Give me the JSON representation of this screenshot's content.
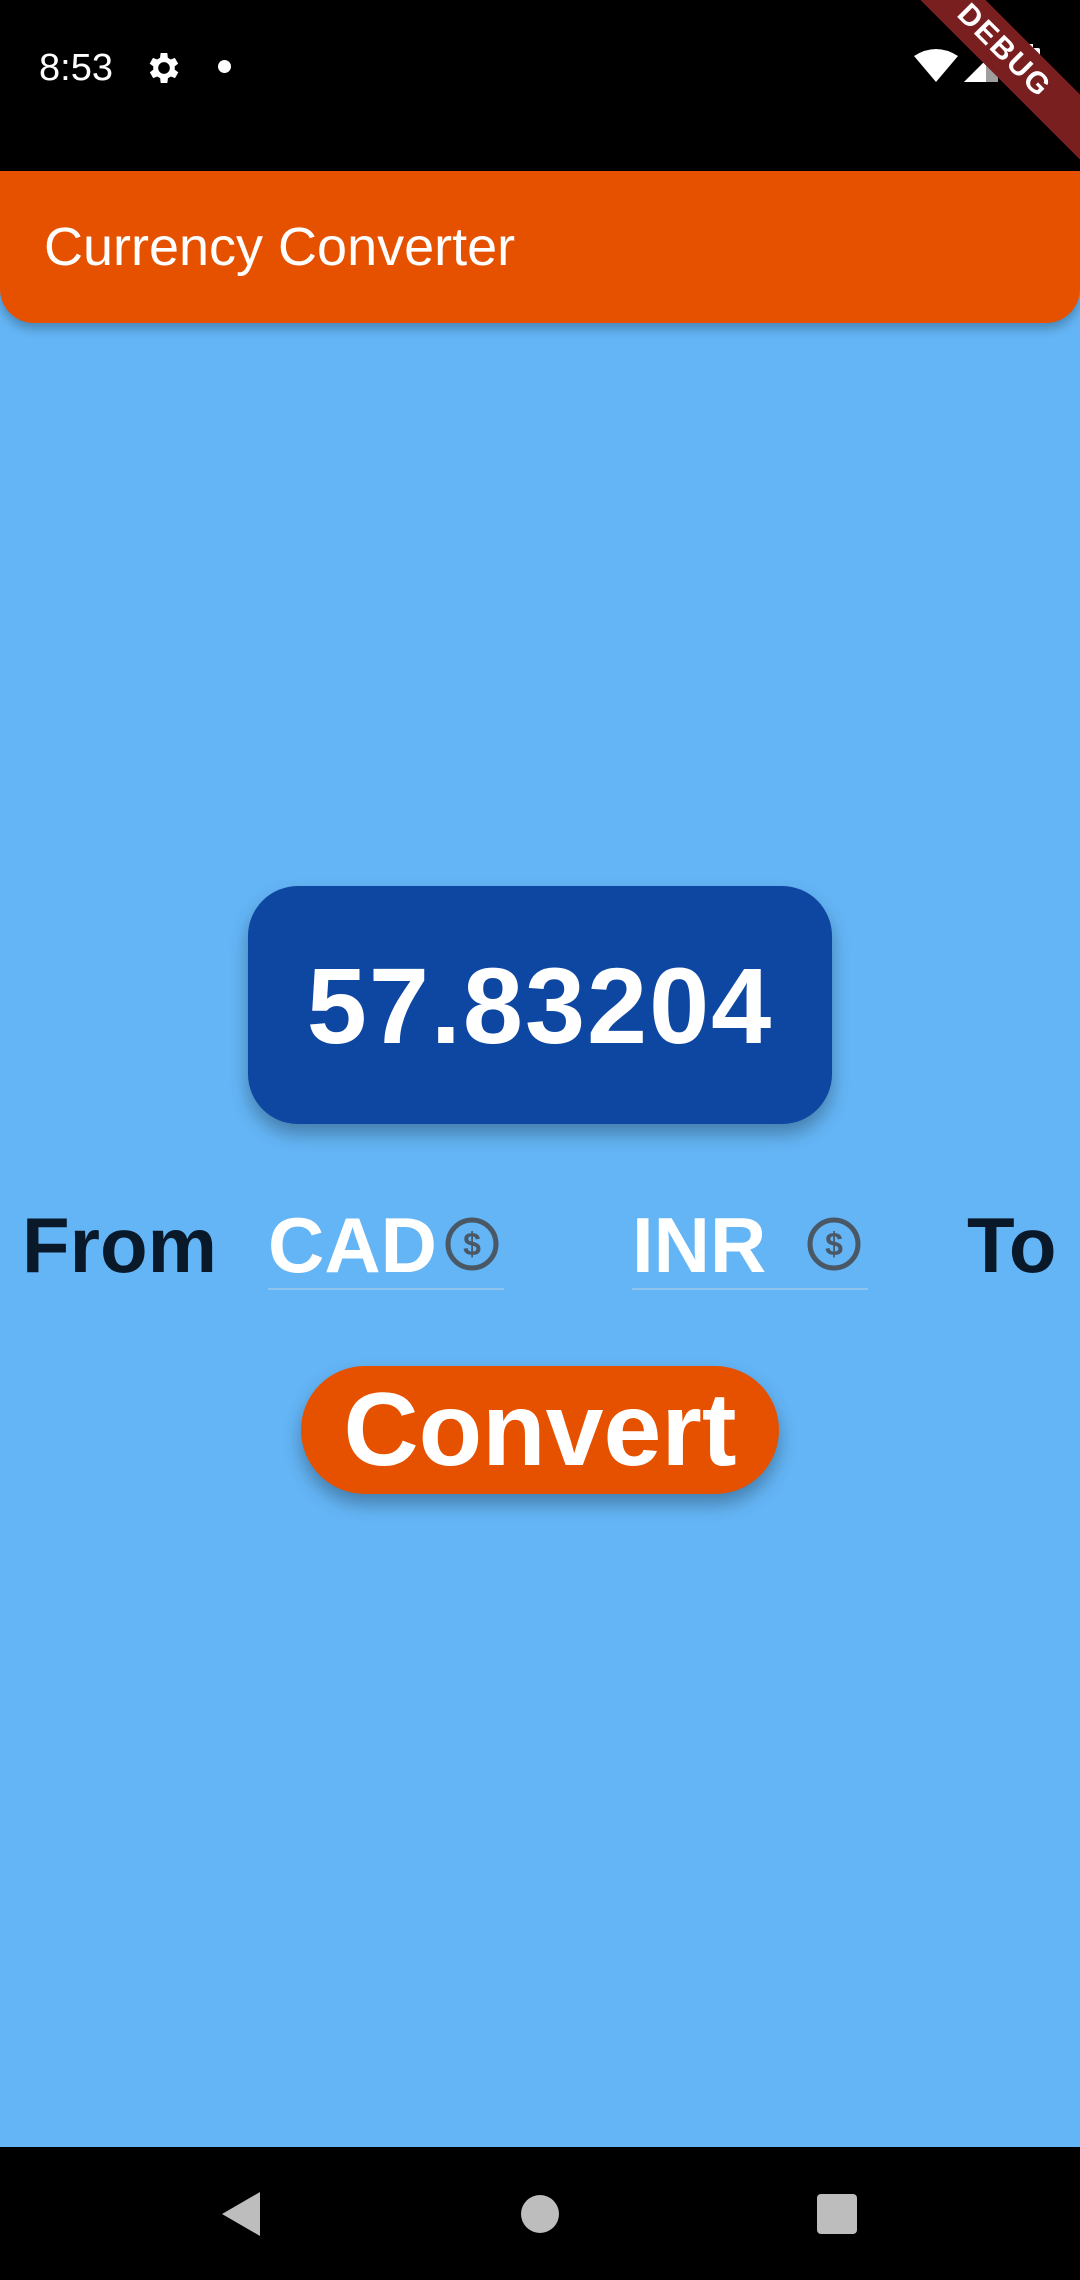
{
  "status_bar": {
    "time": "8:53",
    "icons": [
      "gear-icon",
      "notification-dot-icon",
      "wifi-icon",
      "signal-icon",
      "battery-icon"
    ]
  },
  "debug_banner": "DEBUG",
  "app_bar": {
    "title": "Currency Converter"
  },
  "result": {
    "value": "57.83204"
  },
  "converter": {
    "from_label": "From",
    "to_label": "To",
    "from_currency": "CAD",
    "to_currency": "INR",
    "currency_icon": "dollar-circle-icon"
  },
  "convert_button": {
    "label": "Convert"
  },
  "navigation": {
    "icons": [
      "back-icon",
      "home-icon",
      "recents-icon"
    ]
  },
  "colors": {
    "background": "#64b5f6",
    "app_bar": "#e65100",
    "result_box": "#0d47a1",
    "button": "#e65100",
    "label_text": "#0a1929"
  }
}
